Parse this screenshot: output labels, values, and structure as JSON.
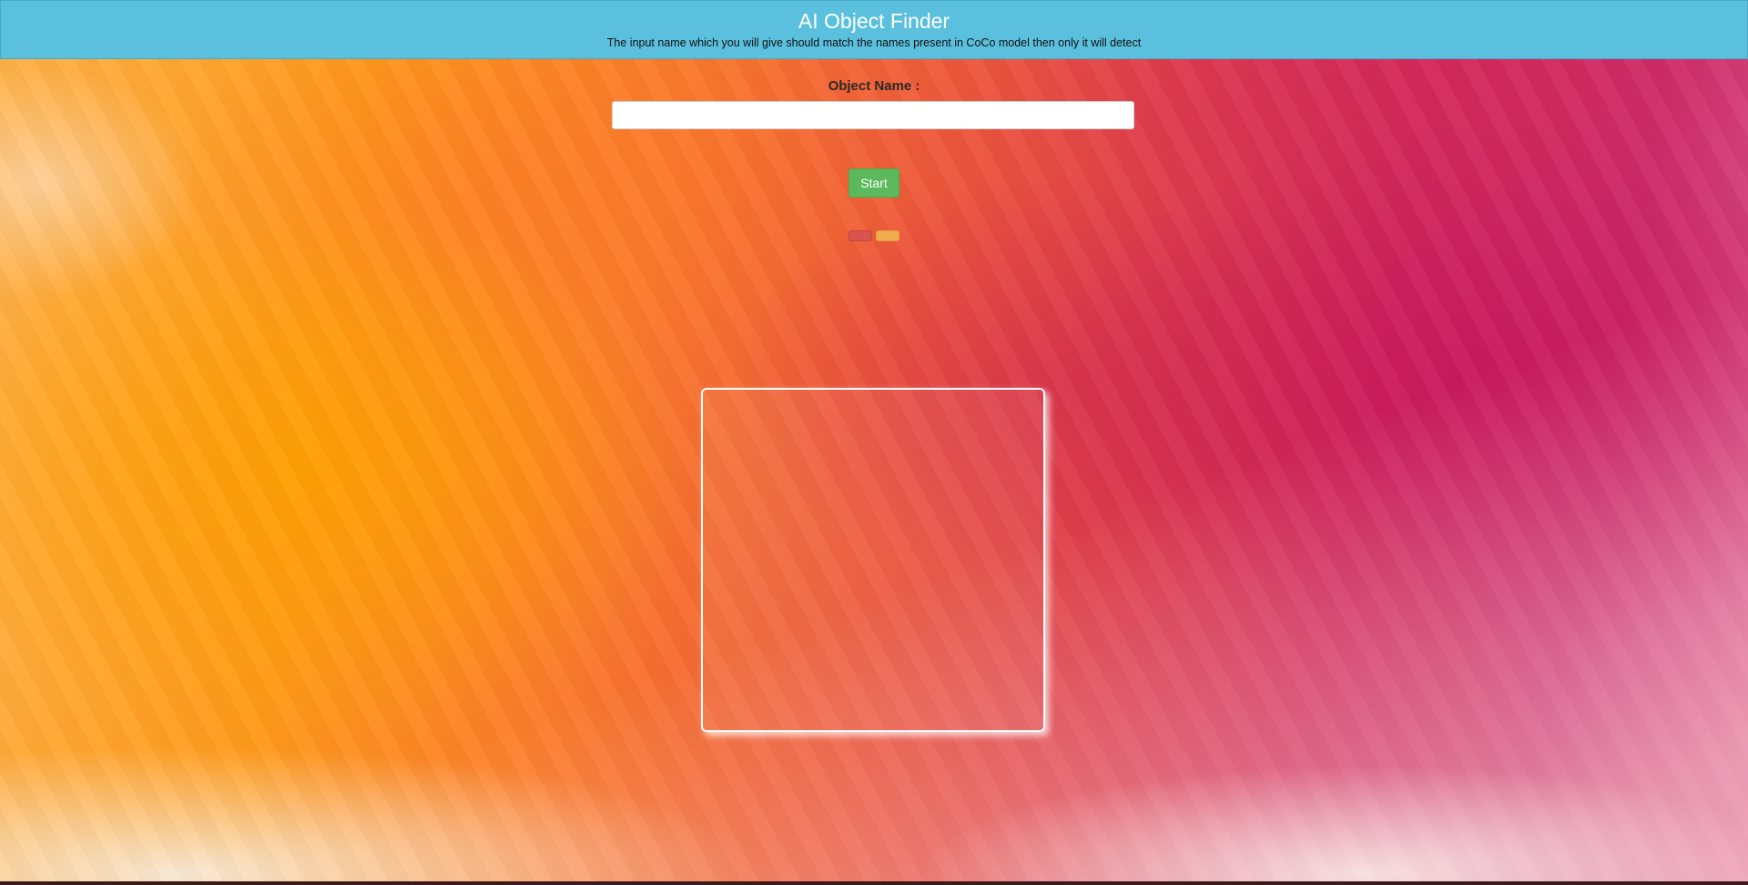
{
  "header": {
    "title": "AI Object Finder",
    "subtitle": "The input name which you will give should match the names present in CoCo model then only it will detect"
  },
  "form": {
    "label": "Object Name :",
    "input_value": "",
    "start_label": "Start"
  },
  "colors": {
    "header_bg": "#5bc0de",
    "start_button": "#5cb85c",
    "mini_button_red": "#d9534f",
    "mini_button_orange": "#f0ad4e"
  }
}
